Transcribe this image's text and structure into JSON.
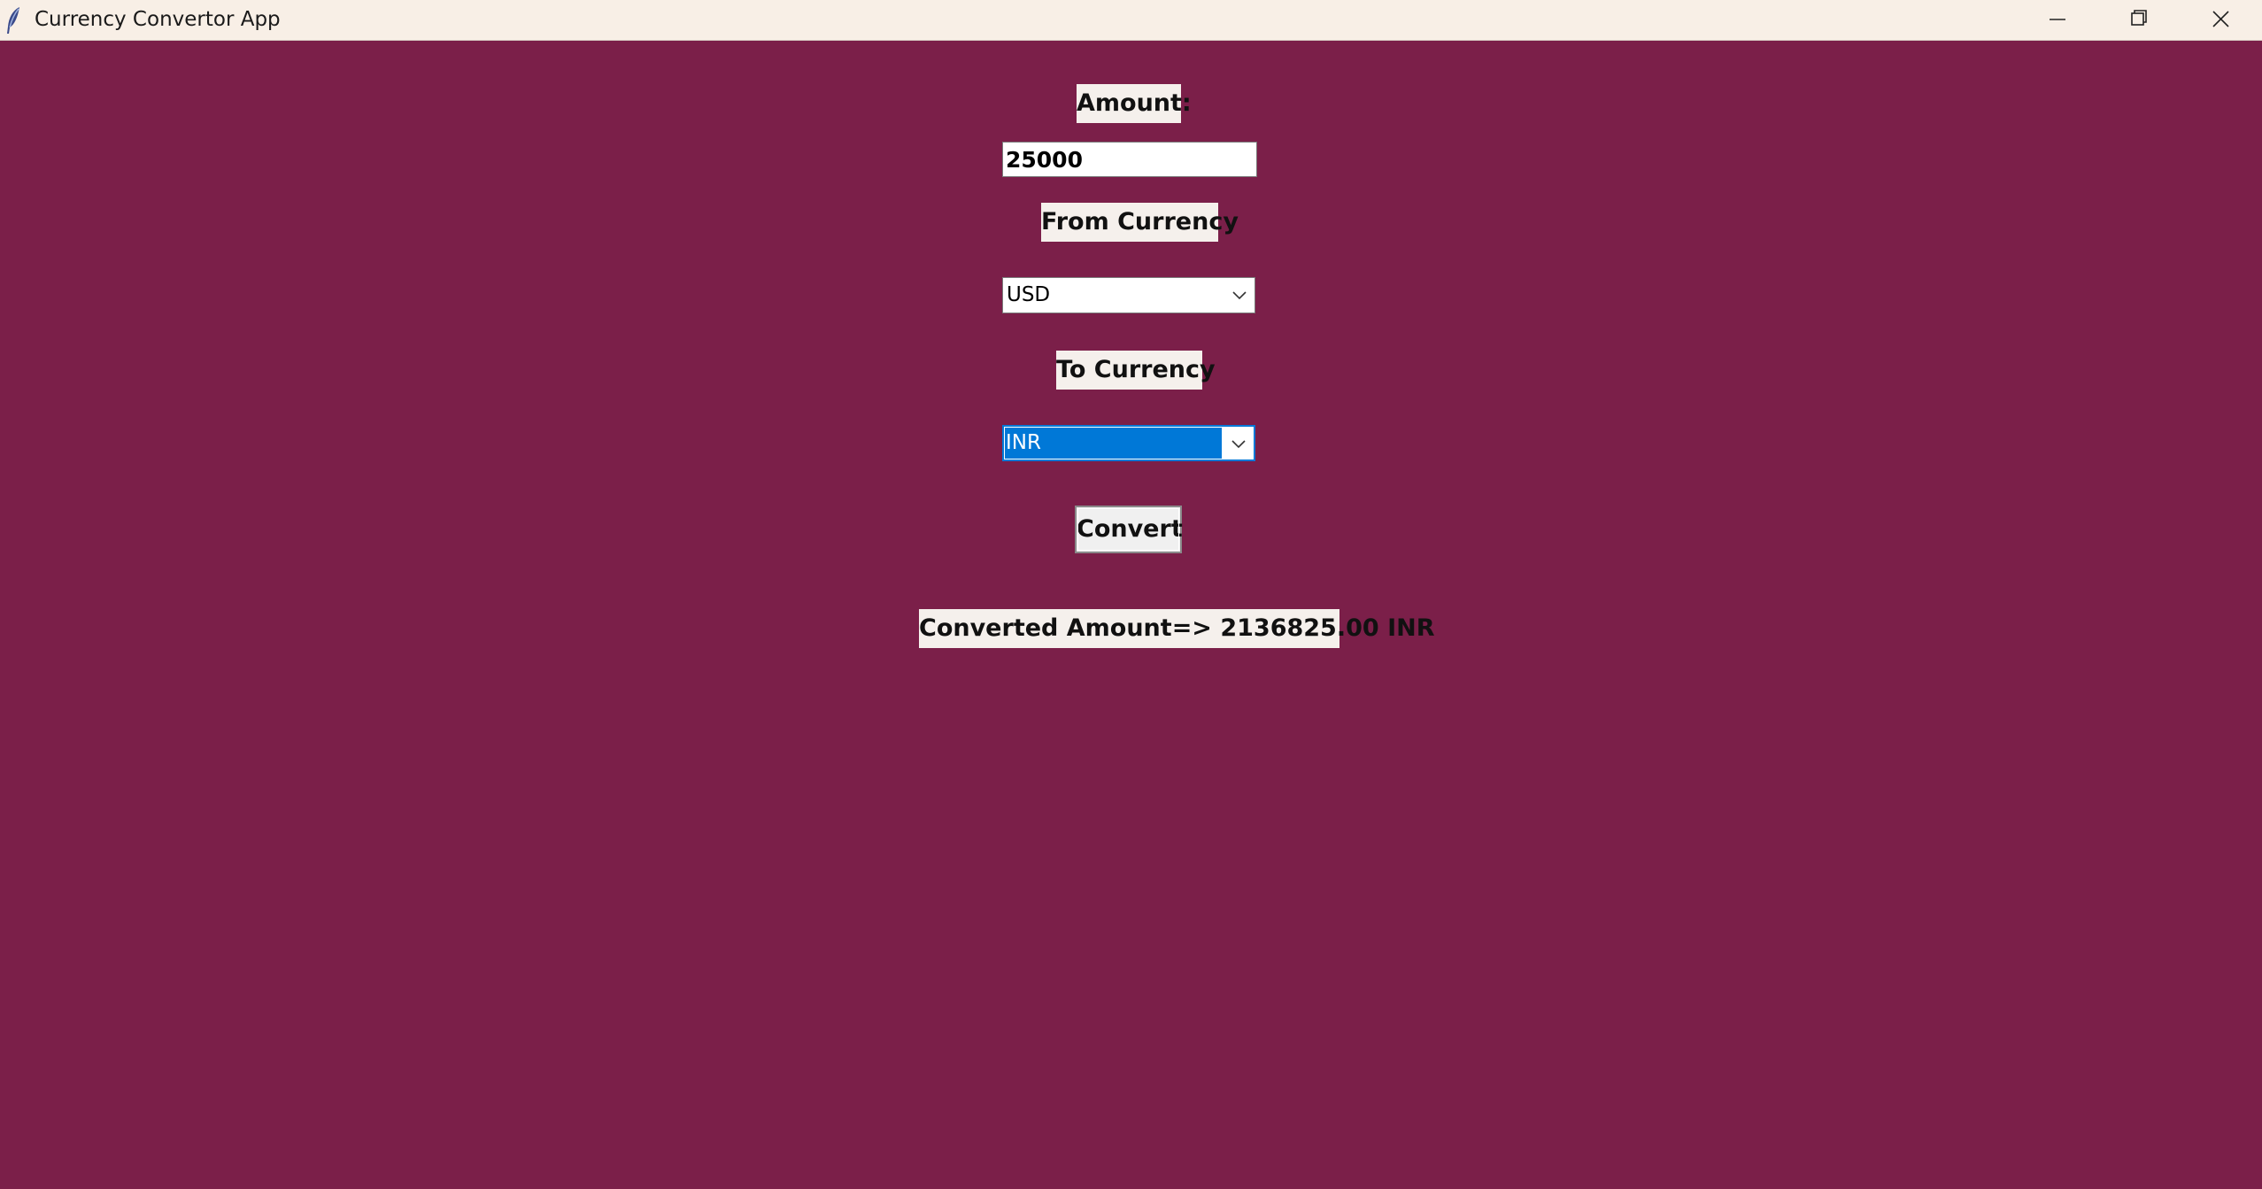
{
  "window": {
    "title": "Currency Convertor App",
    "app_icon": "feather-icon",
    "controls": {
      "minimize_icon": "minimize-icon",
      "maximize_icon": "restore-icon",
      "close_icon": "close-icon"
    }
  },
  "form": {
    "amount_label": "Amount:",
    "amount_value": "25000",
    "from_label": "From Currency",
    "from_value": "USD",
    "to_label": "To Currency",
    "to_value": "INR",
    "convert_label": "Convert",
    "result_text": "Converted Amount=> 2136825.00 INR"
  },
  "colors": {
    "background": "#7b1f49",
    "titlebar": "#f8efe6",
    "label_bg": "#f5f0ec",
    "selection": "#0078d7"
  }
}
